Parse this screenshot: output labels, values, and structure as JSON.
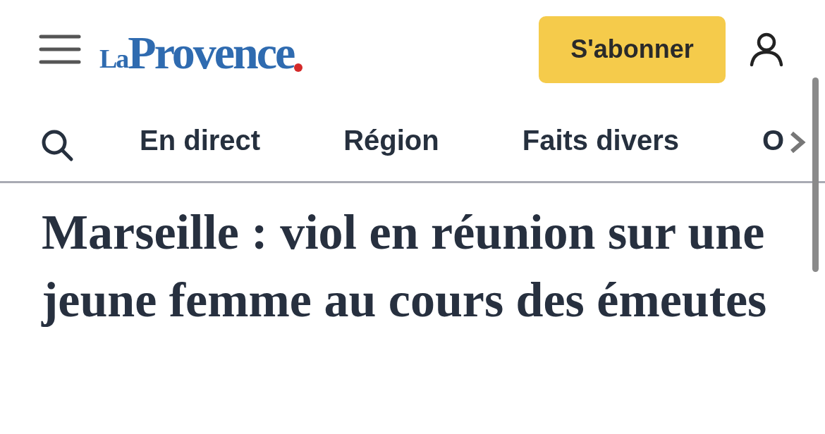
{
  "header": {
    "logo": {
      "prefix": "La",
      "name": "Provence"
    },
    "subscribe_button": "S'abonner"
  },
  "nav": {
    "items": [
      {
        "label": "En direct"
      },
      {
        "label": "Région"
      },
      {
        "label": "Faits divers"
      },
      {
        "label": "O"
      }
    ]
  },
  "article": {
    "headline": "Marseille : viol en réunion sur une jeune femme au cours des émeutes"
  }
}
